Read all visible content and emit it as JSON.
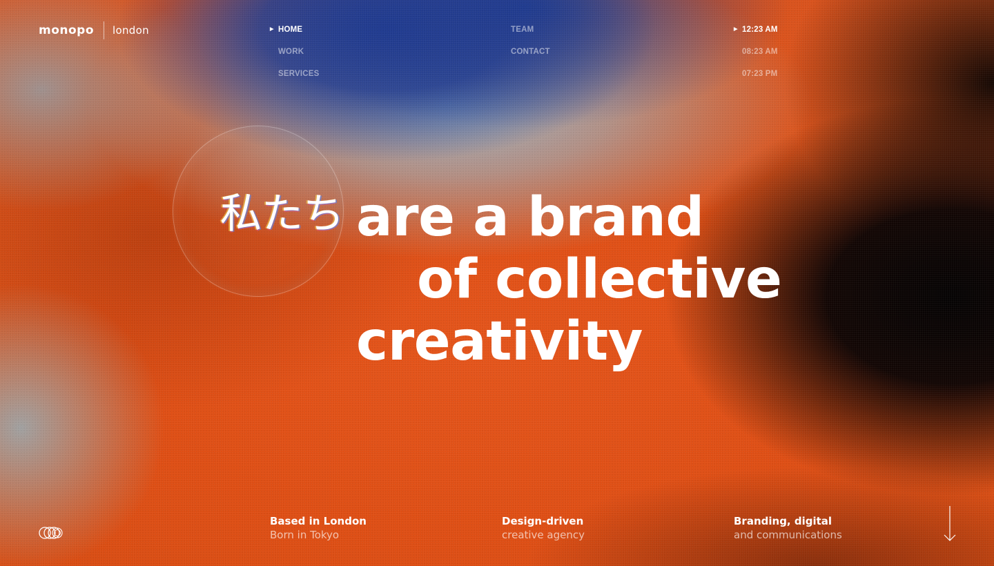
{
  "brand": {
    "name": "monopo",
    "city": "london"
  },
  "nav": {
    "col1": [
      {
        "label": "HOME",
        "active": true
      },
      {
        "label": "WORK",
        "active": false
      },
      {
        "label": "SERVICES",
        "active": false
      }
    ],
    "col2": [
      {
        "label": "TEAM",
        "active": false
      },
      {
        "label": "CONTACT",
        "active": false
      }
    ],
    "clocks": [
      {
        "label": "12:23 AM",
        "active": true
      },
      {
        "label": "08:23 AM",
        "active": false
      },
      {
        "label": "07:23 PM",
        "active": false
      }
    ]
  },
  "hero": {
    "lens_text": "私たち",
    "line1": "are a brand",
    "line2": "of collective",
    "line3": "creativity"
  },
  "footer": {
    "col1": {
      "title": "Based in London",
      "sub": "Born in Tokyo"
    },
    "col2": {
      "title": "Design-driven",
      "sub": "creative agency"
    },
    "col3": {
      "title": "Branding, digital",
      "sub": "and communications"
    }
  },
  "icons": {
    "nav_marker": "triangle-right-icon",
    "footer_logo": "rings-logo-icon",
    "scroll": "arrow-down-icon"
  },
  "colors": {
    "accent_orange": "#e05216",
    "deep_blue": "#1f3a8f",
    "text": "#ffffff"
  }
}
